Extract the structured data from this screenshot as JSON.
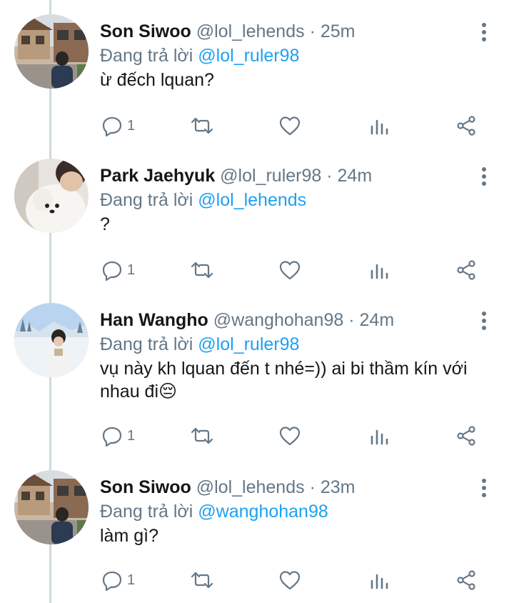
{
  "replying_label": "Đang trả lời",
  "tweets": [
    {
      "name": "Son Siwoo",
      "handle": "@lol_lehends",
      "time": "25m",
      "replying_to": "@lol_ruler98",
      "text": "ừ đếch lquan?",
      "reply_count": "1",
      "avatar": "avatar-son-siwoo"
    },
    {
      "name": "Park Jaehyuk",
      "handle": "@lol_ruler98",
      "time": "24m",
      "replying_to": "@lol_lehends",
      "text": "?",
      "reply_count": "1",
      "avatar": "avatar-park-jaehyuk"
    },
    {
      "name": "Han Wangho",
      "handle": "@wanghohan98",
      "time": "24m",
      "replying_to": "@lol_ruler98",
      "text": "vụ này kh lquan đến t nhé=)) ai bi thầm kín với nhau đi😔",
      "reply_count": "1",
      "avatar": "avatar-han-wangho"
    },
    {
      "name": "Son Siwoo",
      "handle": "@lol_lehends",
      "time": "23m",
      "replying_to": "@wanghohan98",
      "text": "làm gì?",
      "reply_count": "1",
      "avatar": "avatar-son-siwoo"
    }
  ],
  "separator": "·",
  "icons": [
    "reply-icon",
    "retweet-icon",
    "like-icon",
    "analytics-icon",
    "share-icon",
    "more-icon"
  ],
  "colors": {
    "name": "#14171a",
    "secondary": "#657786",
    "mention": "#1da1f2",
    "thread_line": "#cfd9de"
  }
}
